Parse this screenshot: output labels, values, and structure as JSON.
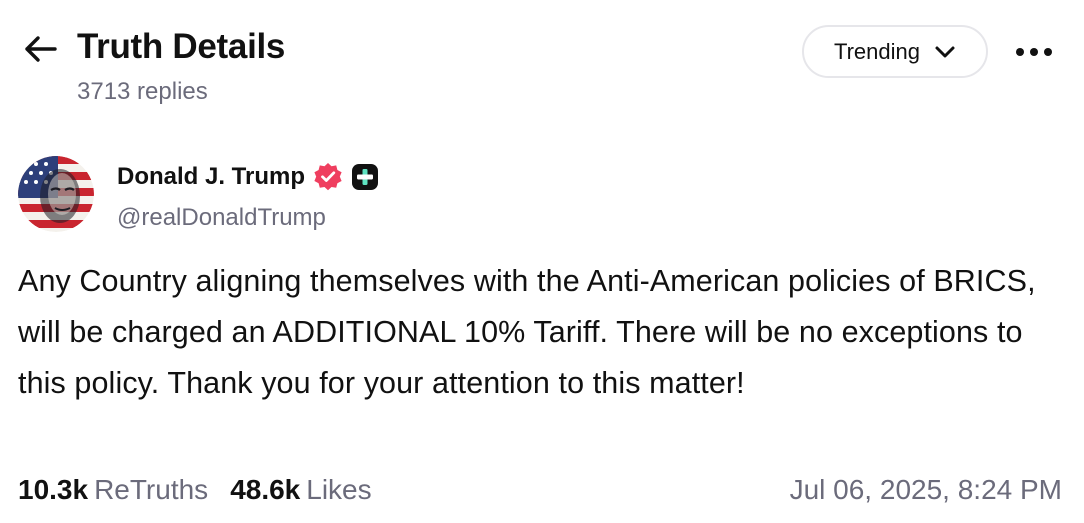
{
  "header": {
    "title": "Truth Details",
    "reply_count": "3713 replies",
    "sort_label": "Trending",
    "back_icon": "arrow-left-icon",
    "more_icon": "more-horizontal-icon"
  },
  "post": {
    "author": {
      "display_name": "Donald J. Trump",
      "handle": "@realDonaldTrump",
      "verified_icon": "verified-badge-icon",
      "plus_icon": "truth-plus-badge-icon",
      "verified_color": "#ef3e5f"
    },
    "body": "Any Country aligning themselves with the Anti-American policies of BRICS, will be charged an ADDITIONAL 10% Tariff. There will be no exceptions to this policy. Thank you for your attention to this matter!",
    "stats": {
      "retruths_count": "10.3k",
      "retruths_label": "ReTruths",
      "likes_count": "48.6k",
      "likes_label": "Likes"
    },
    "timestamp": "Jul 06, 2025, 8:24 PM"
  }
}
